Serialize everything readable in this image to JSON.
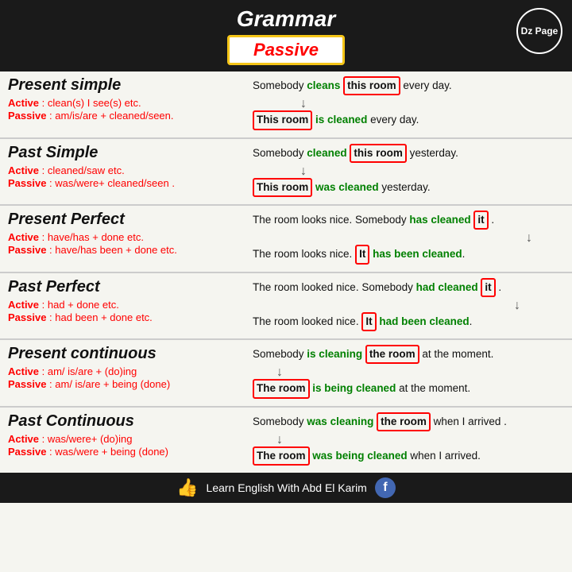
{
  "header": {
    "title": "Grammar",
    "passive_label": "Passive",
    "dz_page": "Dz Page"
  },
  "sections": [
    {
      "id": "present-simple",
      "title": "Present simple",
      "active_rule": "Active : clean(s) I see(s) etc.",
      "passive_rule": "Passive : am/is/are + cleaned/seen.",
      "example_active": "Somebody",
      "example_active_verb": "cleans",
      "example_active_boxed": "this room",
      "example_active_end": "every day.",
      "example_passive_boxed": "This room",
      "example_passive_verb": "is cleaned",
      "example_passive_end": "every day."
    },
    {
      "id": "past-simple",
      "title": "Past Simple",
      "active_rule": "Active : cleaned/saw etc.",
      "passive_rule": "Passive : was/were+ cleaned/seen .",
      "example_active_pre": "Somebody",
      "example_active_verb": "cleaned",
      "example_active_boxed": "this room",
      "example_active_end": "yesterday.",
      "example_passive_boxed": "This room",
      "example_passive_verb": "was cleaned",
      "example_passive_end": "yesterday."
    },
    {
      "id": "present-perfect",
      "title": "Present Perfect",
      "active_rule": "Active :  have/has + done etc.",
      "passive_rule": "Passive : have/has been + done etc.",
      "example_active_pre": "The room looks nice. Somebody",
      "example_active_verb": "has cleaned",
      "example_active_boxed": "it",
      "example_active_end": ".",
      "example_passive_pre": "The room looks nice.",
      "example_passive_boxed": "It",
      "example_passive_verb": "has been cleaned",
      "example_passive_end": "."
    },
    {
      "id": "past-perfect",
      "title": "Past Perfect",
      "active_rule": "Active : had + done etc.",
      "passive_rule": "Passive : had been + done etc.",
      "example_active_pre": "The room looked nice. Somebody",
      "example_active_verb": "had cleaned",
      "example_active_boxed": "it",
      "example_active_end": ".",
      "example_passive_pre": "The room looked nice.",
      "example_passive_boxed": "It",
      "example_passive_verb": "had been cleaned",
      "example_passive_end": "."
    },
    {
      "id": "present-continuous",
      "title": "Present continuous",
      "active_rule": "Active : am/ is/are + (do)ing",
      "passive_rule": "Passive : am/ is/are + being (done)",
      "example_active_pre": "Somebody",
      "example_active_verb": "is cleaning",
      "example_active_boxed": "the room",
      "example_active_end": "at the moment.",
      "example_passive_boxed": "The room",
      "example_passive_verb": "is being cleaned",
      "example_passive_end": "at the moment."
    },
    {
      "id": "past-continuous",
      "title": "Past Continuous",
      "active_rule": "Active : was/were+ (do)ing",
      "passive_rule": "Passive : was/were + being (done)",
      "example_active_pre": "Somebody",
      "example_active_verb": "was cleaning",
      "example_active_boxed": "the room",
      "example_active_end": "when I arrived .",
      "example_passive_boxed": "The room",
      "example_passive_verb": "was being cleaned",
      "example_passive_end": "when I arrived."
    }
  ],
  "footer": {
    "label": "Learn English With Abd El Karim",
    "thumbs_up": "👍"
  }
}
